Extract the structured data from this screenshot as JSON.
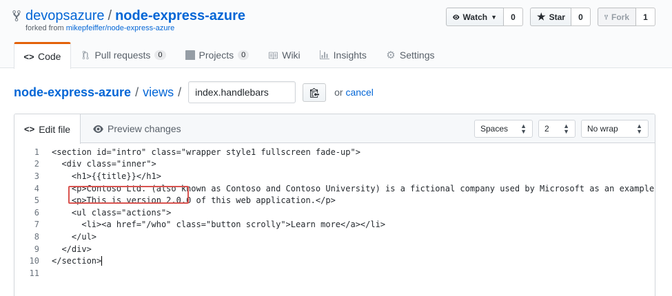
{
  "repo": {
    "owner": "devopsazure",
    "separator": "/",
    "name": "node-express-azure",
    "forked_prefix": "forked from",
    "forked_from": "mikepfeiffer/node-express-azure"
  },
  "actions": {
    "watch": {
      "label": "Watch",
      "count": "0"
    },
    "star": {
      "label": "Star",
      "count": "0"
    },
    "fork": {
      "label": "Fork",
      "count": "1"
    }
  },
  "tabs": [
    {
      "label": "Code",
      "icon": "code-icon",
      "selected": true
    },
    {
      "label": "Pull requests",
      "count": "0",
      "icon": "pull-request-icon"
    },
    {
      "label": "Projects",
      "count": "0",
      "icon": "project-icon"
    },
    {
      "label": "Wiki",
      "icon": "book-icon"
    },
    {
      "label": "Insights",
      "icon": "graph-icon"
    },
    {
      "label": "Settings",
      "icon": "gear-icon"
    }
  ],
  "breadcrumb": {
    "repo": "node-express-azure",
    "folder": "views",
    "slash": "/",
    "filename": "index.handlebars",
    "or": "or",
    "cancel": "cancel"
  },
  "editor": {
    "edit_tab": "Edit file",
    "preview_tab": "Preview changes",
    "indent_mode": "Spaces",
    "indent_size": "2",
    "wrap_mode": "No wrap",
    "lines": [
      {
        "num": "1",
        "text": "<section id=\"intro\" class=\"wrapper style1 fullscreen fade-up\">"
      },
      {
        "num": "2",
        "text": "  <div class=\"inner\">"
      },
      {
        "num": "3",
        "text": "    <h1>{{title}}</h1>"
      },
      {
        "num": "4",
        "text": "    <p>Contoso Ltd. (also known as Contoso and Contoso University) is a fictional company used by Microsoft as an example compar"
      },
      {
        "num": "5",
        "text": "    <p>This is version 2.0.0 of this web application.</p>"
      },
      {
        "num": "6",
        "text": "    <ul class=\"actions\">"
      },
      {
        "num": "7",
        "text": "      <li><a href=\"/who\" class=\"button scrolly\">Learn more</a></li>"
      },
      {
        "num": "8",
        "text": "    </ul>"
      },
      {
        "num": "9",
        "text": "  </div>"
      },
      {
        "num": "10",
        "text": "</section>"
      },
      {
        "num": "11",
        "text": ""
      }
    ]
  },
  "colors": {
    "link": "#0366d6",
    "tab_accent": "#e36209",
    "annotation_box": "#d9534f"
  }
}
